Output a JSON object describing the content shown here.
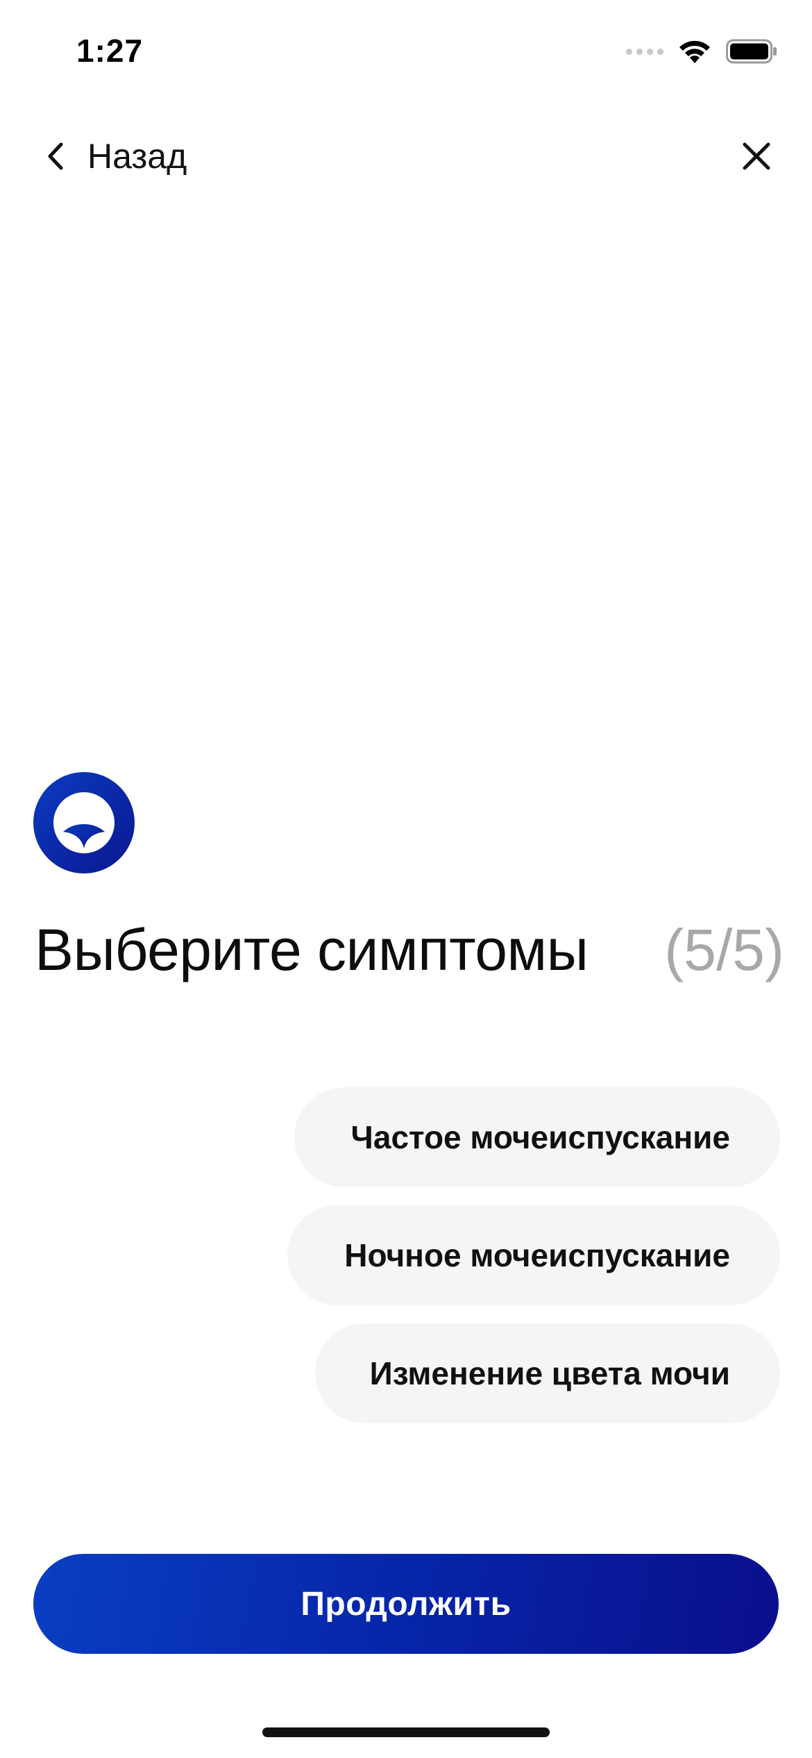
{
  "status_bar": {
    "time": "1:27",
    "icons": [
      "cellular-signal-icon",
      "wifi-icon",
      "battery-icon"
    ]
  },
  "nav": {
    "back_label": "Назад",
    "back_icon": "chevron-left-icon",
    "close_icon": "close-icon"
  },
  "logo": {
    "icon": "brand-logo-icon",
    "colors": {
      "primary": "#0b2aa8",
      "inner": "#ffffff"
    }
  },
  "title": {
    "text": "Выберите симптомы",
    "step": "(5/5)"
  },
  "options": [
    {
      "label": "Частое мочеиспускание"
    },
    {
      "label": "Ночное мочеиспускание"
    },
    {
      "label": "Изменение цвета мочи"
    }
  ],
  "continue": {
    "label": "Продолжить"
  },
  "colors": {
    "accent_start": "#0a3ec2",
    "accent_end": "#0a0f8c",
    "chip_background": "#f5f5f5",
    "muted_text": "#a8a8a8"
  }
}
